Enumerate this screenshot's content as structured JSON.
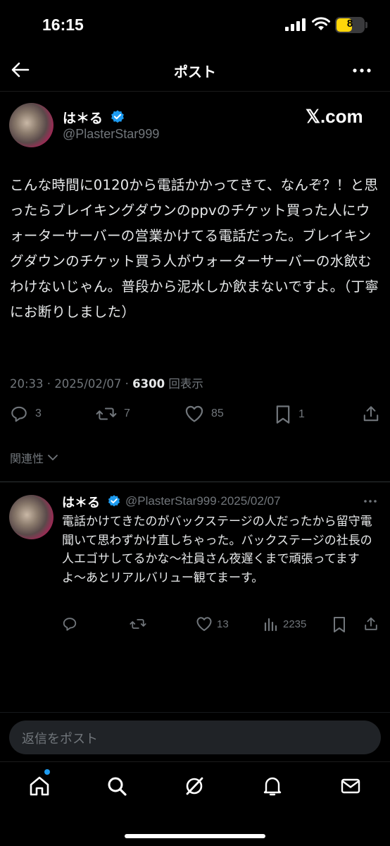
{
  "status_bar": {
    "time": "16:15",
    "battery": "8"
  },
  "nav": {
    "title": "ポスト"
  },
  "post": {
    "author_name": "は＊る",
    "author_handle": "@PlasterStar999",
    "watermark": "𝕏.com",
    "body": "こんな時間に0120から電話かかってきて、なんぞ？！と思ったらブレイキングダウンのppvのチケット買った人にウォーターサーバーの営業かけてる電話だった。ブレイキングダウンのチケット買う人がウォーターサーバーの水飲むわけないじゃん。普段から泥水しか飲まないですよ。（丁寧にお断りしました）",
    "time": "20:33",
    "date": "2025/02/07",
    "views_count": "6300",
    "views_label": "回表示",
    "replies": "3",
    "reposts": "7",
    "likes": "85",
    "bookmarks": "1"
  },
  "sort": {
    "label": "関連性"
  },
  "reply": {
    "author_name": "は＊る",
    "author_handle": "@PlasterStar999",
    "date": "2025/02/07",
    "body": "電話かけてきたのがバックステージの人だったから留守電聞いて思わずかけ直しちゃった。バックステージの社長の人エゴサしてるかな〜社員さん夜遅くまで頑張ってますよ〜あとリアルバリュー観てまーす。",
    "likes": "13",
    "views": "2235"
  },
  "composer": {
    "placeholder": "返信をポスト"
  },
  "colors": {
    "accent": "#1d9bf0",
    "muted": "#71767b",
    "text": "#e7e9ea",
    "background": "#000000"
  }
}
